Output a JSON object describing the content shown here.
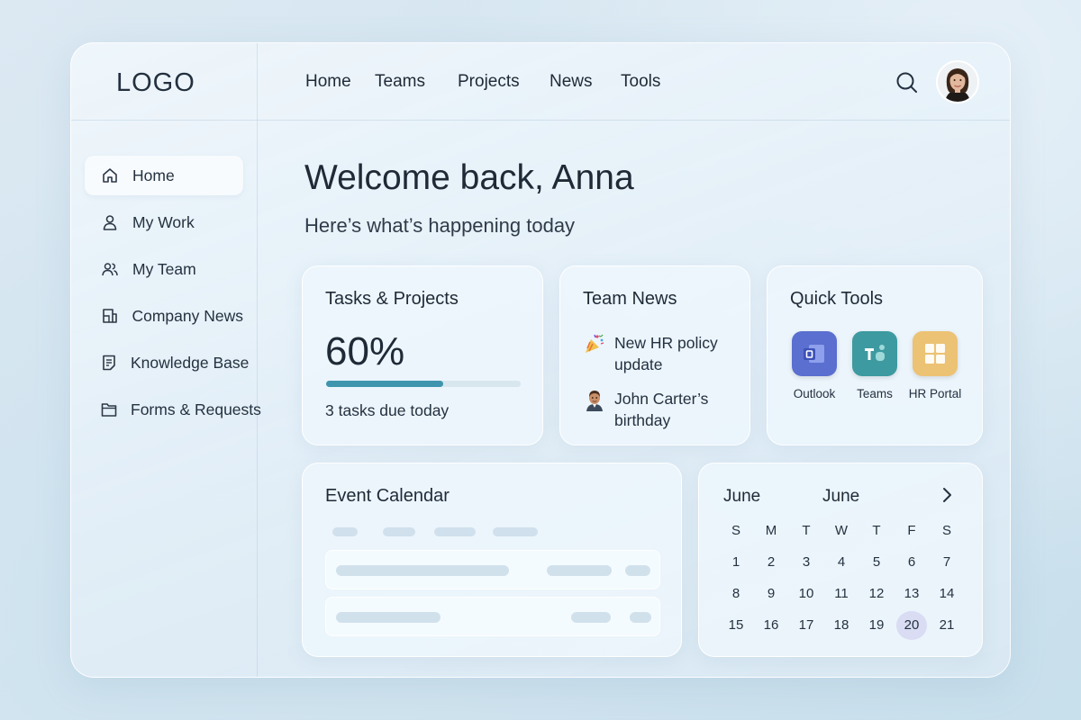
{
  "header": {
    "logo": "LOGO",
    "nav": [
      "Home",
      "Teams",
      "Projects",
      "News",
      "Tools"
    ]
  },
  "sidebar": {
    "items": [
      {
        "label": "Home",
        "icon": "home-icon",
        "active": true
      },
      {
        "label": "My Work",
        "icon": "user-icon"
      },
      {
        "label": "My Team",
        "icon": "users-icon"
      },
      {
        "label": "Company News",
        "icon": "newspaper-icon"
      },
      {
        "label": "Knowledge Base",
        "icon": "document-icon"
      },
      {
        "label": "Forms & Requests",
        "icon": "folder-icon"
      }
    ]
  },
  "main": {
    "welcome": "Welcome back, Anna",
    "subtitle": "Here’s what’s happening today"
  },
  "tasks": {
    "title": "Tasks & Projects",
    "percent_text": "60%",
    "progress": 0.6,
    "due": "3 tasks due today",
    "accent": "#3e95ad"
  },
  "news": {
    "title": "Team News",
    "items": [
      {
        "text": "New HR policy update",
        "icon": "party-popper-icon"
      },
      {
        "text": "John Carter’s birthday",
        "icon": "person-emoji-icon"
      }
    ]
  },
  "tools": {
    "title": "Quick Tools",
    "items": [
      {
        "label": "Outlook",
        "icon": "outlook-icon",
        "color": "#5a6fcf"
      },
      {
        "label": "Teams",
        "icon": "teams-icon",
        "color": "#3d9aa0"
      },
      {
        "label": "HR Portal",
        "icon": "hr-portal-icon",
        "color": "#ecc274"
      }
    ]
  },
  "events": {
    "title": "Event Calendar"
  },
  "calendar": {
    "month_left": "June",
    "month_center": "June",
    "weekdays": [
      "S",
      "M",
      "T",
      "W",
      "T",
      "F",
      "S"
    ],
    "weeks": [
      [
        "1",
        "2",
        "3",
        "4",
        "5",
        "6",
        "7"
      ],
      [
        "8",
        "9",
        "10",
        "11",
        "12",
        "13",
        "14"
      ],
      [
        "15",
        "16",
        "17",
        "18",
        "19",
        "20",
        "21"
      ]
    ],
    "selected": "20",
    "selected_color": "#d9dcf3"
  }
}
